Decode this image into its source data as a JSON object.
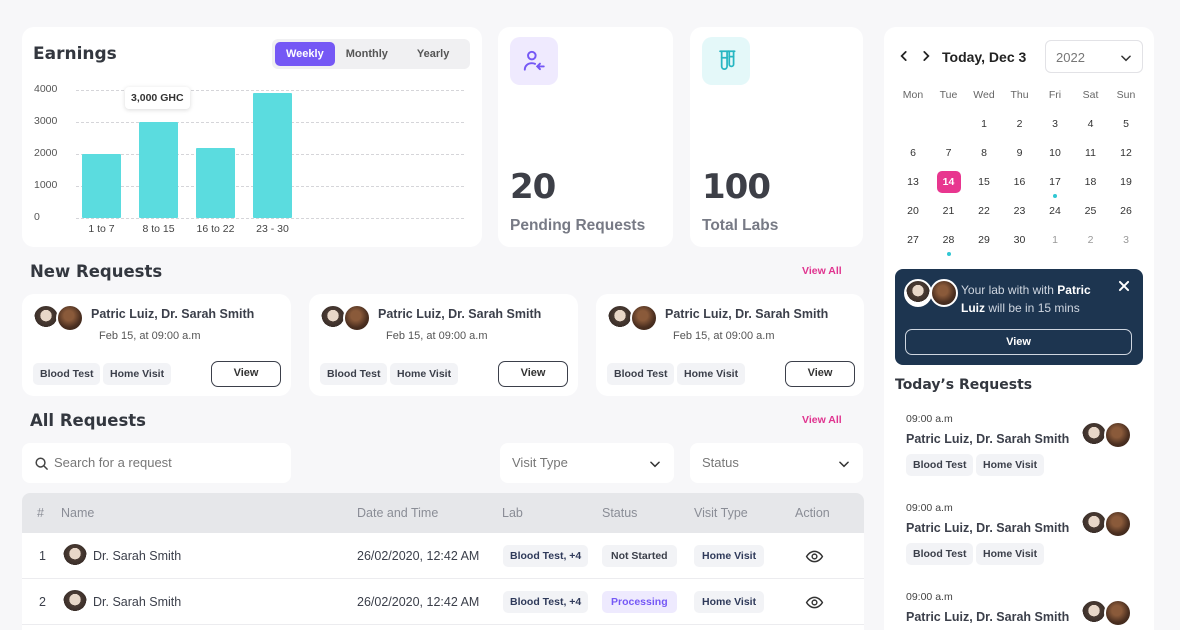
{
  "earnings": {
    "title": "Earnings",
    "tabs": [
      "Weekly",
      "Monthly",
      "Yearly"
    ],
    "active_tab": "Weekly",
    "tooltip": "3,000 GHC",
    "accent": "#7558f5",
    "bar_color": "#5bdcdf"
  },
  "chart_data": {
    "type": "bar",
    "title": "Earnings",
    "categories": [
      "1 to 7",
      "8 to 15",
      "16 to 22",
      "23 - 30"
    ],
    "values": [
      2000,
      3000,
      2200,
      3900
    ],
    "yticks": [
      "4000",
      "3000",
      "2000",
      "1000",
      "0"
    ],
    "ylim": [
      0,
      4000
    ],
    "grid": true
  },
  "stats": {
    "pending": {
      "value": "20",
      "label": "Pending Requests",
      "icon": "user-arrow-icon"
    },
    "labs": {
      "value": "100",
      "label": "Total Labs",
      "icon": "test-tubes-icon"
    }
  },
  "new_requests": {
    "title": "New Requests",
    "view_all": "View All",
    "cards": [
      {
        "names": "Patric Luiz, Dr. Sarah Smith",
        "date": "Feb 15, at 09:00 a.m",
        "tags": [
          "Blood Test",
          "Home Visit"
        ],
        "button": "View"
      },
      {
        "names": "Patric Luiz, Dr. Sarah Smith",
        "date": "Feb 15, at 09:00 a.m",
        "tags": [
          "Blood Test",
          "Home Visit"
        ],
        "button": "View"
      },
      {
        "names": "Patric Luiz, Dr. Sarah Smith",
        "date": "Feb 15, at 09:00 a.m",
        "tags": [
          "Blood Test",
          "Home Visit"
        ],
        "button": "View"
      }
    ]
  },
  "all_requests": {
    "title": "All Requests",
    "view_all": "View All",
    "search_placeholder": "Search for a request",
    "filter_visit": "Visit Type",
    "filter_status": "Status",
    "columns": [
      "#",
      "Name",
      "Date and Time",
      "Lab",
      "Status",
      "Visit Type",
      "Action"
    ],
    "rows": [
      {
        "num": "1",
        "name": "Dr. Sarah Smith",
        "datetime": "26/02/2020, 12:42 AM",
        "lab": "Blood Test, +4",
        "status": "Not Started",
        "visit": "Home Visit"
      },
      {
        "num": "2",
        "name": "Dr. Sarah Smith",
        "datetime": "26/02/2020, 12:42 AM",
        "lab": "Blood Test, +4",
        "status": "Processing",
        "visit": "Home Visit"
      }
    ]
  },
  "calendar": {
    "title": "Today, Dec 3",
    "year": "2022",
    "dow": [
      "Mon",
      "Tue",
      "Wed",
      "Thu",
      "Fri",
      "Sat",
      "Sun"
    ],
    "weeks": [
      [
        "",
        "",
        "1",
        "2",
        "3",
        "4",
        "5"
      ],
      [
        "6",
        "7",
        "8",
        "9",
        "10",
        "11",
        "12"
      ],
      [
        "13",
        "14",
        "15",
        "16",
        "17",
        "18",
        "19"
      ],
      [
        "20",
        "21",
        "22",
        "23",
        "24",
        "25",
        "26"
      ],
      [
        "27",
        "28",
        "29",
        "30",
        "1",
        "2",
        "3"
      ]
    ],
    "selected": "14",
    "highlight_color": "#e8368f"
  },
  "notification": {
    "text_pre": "Your lab with with ",
    "text_name1": "Patric",
    "text_name2": "Luiz",
    "text_post": " will be in 15 mins",
    "button": "View",
    "bg": "#1d3550"
  },
  "today": {
    "title": "Today’s Requests",
    "items": [
      {
        "time": "09:00 a.m",
        "names": "Patric Luiz, Dr. Sarah Smith",
        "tags": [
          "Blood Test",
          "Home Visit"
        ]
      },
      {
        "time": "09:00 a.m",
        "names": "Patric Luiz, Dr. Sarah Smith",
        "tags": [
          "Blood Test",
          "Home Visit"
        ]
      },
      {
        "time": "09:00 a.m",
        "names": "Patric Luiz, Dr. Sarah Smith",
        "tags": []
      }
    ]
  }
}
